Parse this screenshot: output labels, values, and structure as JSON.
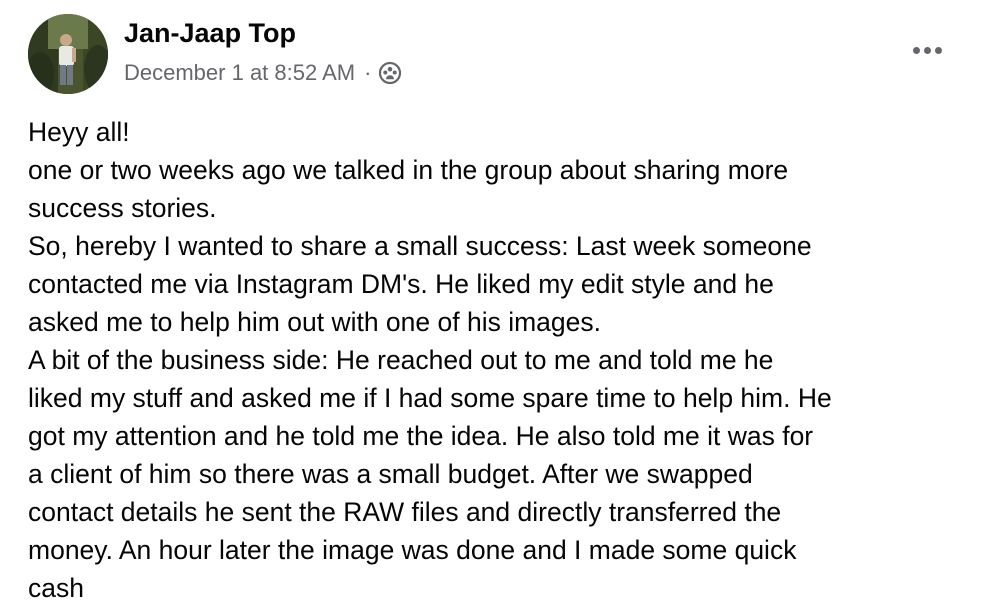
{
  "author": {
    "name": "Jan-Jaap Top",
    "avatar_icon": "profile-photo"
  },
  "meta": {
    "timestamp": "December 1 at 8:52 AM",
    "separator": "·",
    "audience_icon": "group-members-icon"
  },
  "more_button_icon": "more-options-icon",
  "post": {
    "paragraphs": [
      "Heyy all!\none or two weeks ago we talked in the group about sharing more\nsuccess stories.",
      "So, hereby I wanted to share a small success: Last week someone\ncontacted me via Instagram DM's. He liked my edit style and he\nasked me to help him out with one of his images.",
      "A bit of the business side: He reached out to me and told me he\nliked my stuff and asked me if I had some spare time to help him. He\ngot my attention and he told me the idea. He also told me it was for\na client of him so there was a small budget. After we swapped\ncontact details he sent the RAW files and directly transferred the\nmoney. An hour later the image was done and I made some quick\ncash"
    ]
  }
}
